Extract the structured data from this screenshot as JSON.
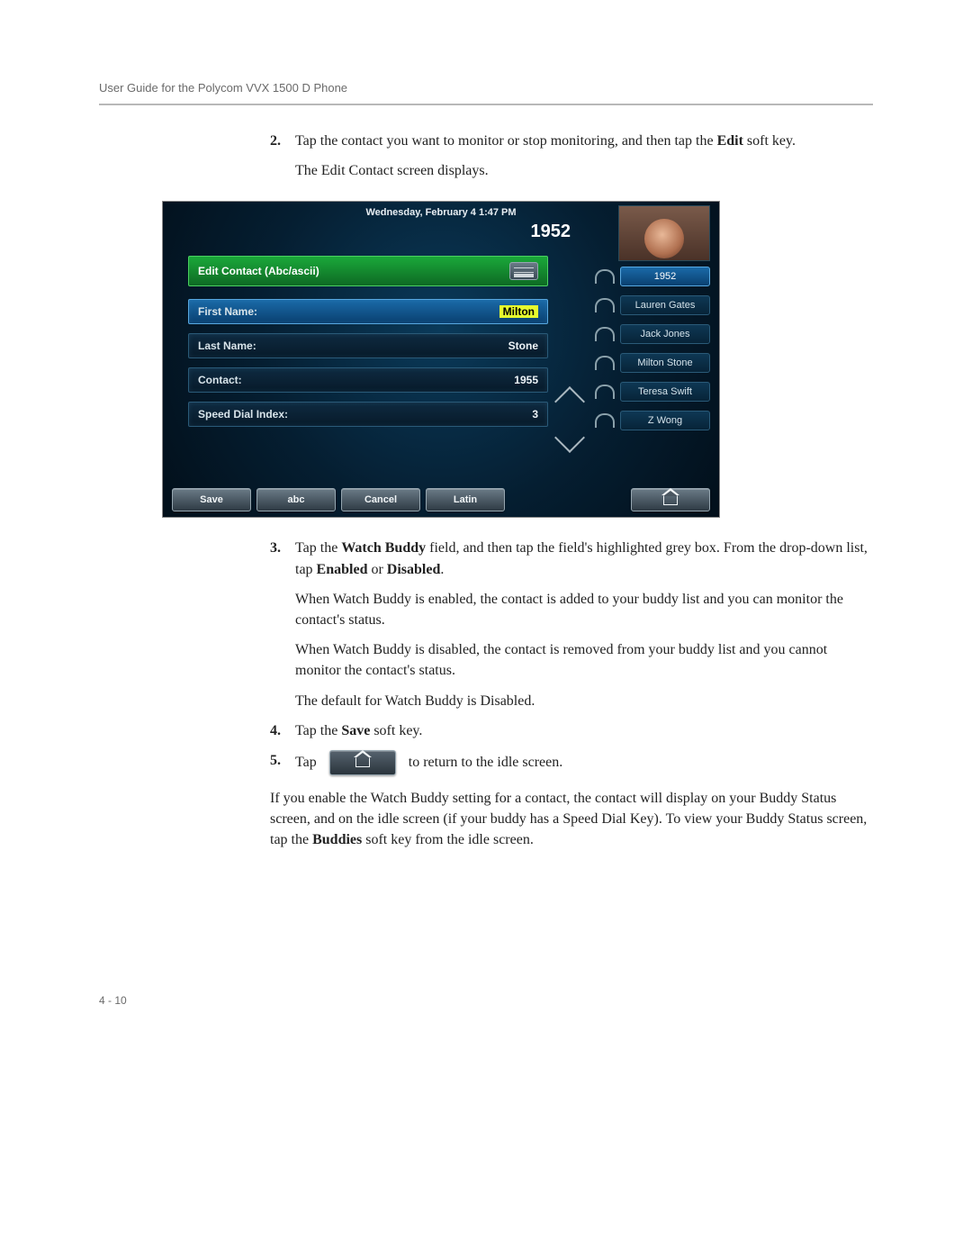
{
  "header": {
    "running_head": "User Guide for the Polycom VVX 1500 D Phone"
  },
  "steps": {
    "s2": {
      "num": "2.",
      "text_a": "Tap the contact you want to monitor or stop monitoring, and then tap the ",
      "text_b_bold": "Edit",
      "text_c": " soft key.",
      "follow": "The Edit Contact screen displays."
    },
    "s3": {
      "num": "3.",
      "text_a": "Tap the ",
      "b1": "Watch Buddy",
      "text_b": " field, and then tap the field's highlighted grey box. From the drop-down list, tap ",
      "b2": "Enabled",
      "text_c": " or ",
      "b3": "Disabled",
      "text_d": ".",
      "p1": "When Watch Buddy is enabled, the contact is added to your buddy list and you can monitor the contact's status.",
      "p2": "When Watch Buddy is disabled, the contact is removed from your buddy list and you cannot monitor the contact's status.",
      "p3": "The default for Watch Buddy is Disabled."
    },
    "s4": {
      "num": "4.",
      "text_a": "Tap the ",
      "b1": "Save",
      "text_b": " soft key."
    },
    "s5": {
      "num": "5.",
      "text_a": "Tap",
      "text_b": "to return to the idle screen."
    }
  },
  "trailing": {
    "t1a": "If you enable the Watch Buddy setting for a contact, the contact will display on your Buddy Status screen, and on the idle screen (if your buddy has a Speed Dial Key). To view your Buddy Status screen, tap the ",
    "t1b_bold": "Buddies",
    "t1c": " soft key from the idle screen."
  },
  "screenshot": {
    "datetime": "Wednesday, February 4  1:47 PM",
    "extension": "1952",
    "panel_title": "Edit Contact (Abc/ascii)",
    "fields": {
      "first_name": {
        "label": "First Name:",
        "value": "Milton"
      },
      "last_name": {
        "label": "Last Name:",
        "value": "Stone"
      },
      "contact": {
        "label": "Contact:",
        "value": "1955"
      },
      "speed_dial": {
        "label": "Speed Dial Index:",
        "value": "3"
      }
    },
    "side": [
      {
        "label": "1952",
        "active": true
      },
      {
        "label": "Lauren Gates"
      },
      {
        "label": "Jack Jones"
      },
      {
        "label": "Milton Stone"
      },
      {
        "label": "Teresa Swift"
      },
      {
        "label": "Z Wong"
      }
    ],
    "softkeys": {
      "k1": "Save",
      "k2": "abc",
      "k3": "Cancel",
      "k4": "Latin"
    }
  },
  "footer": {
    "page": "4 - 10"
  }
}
